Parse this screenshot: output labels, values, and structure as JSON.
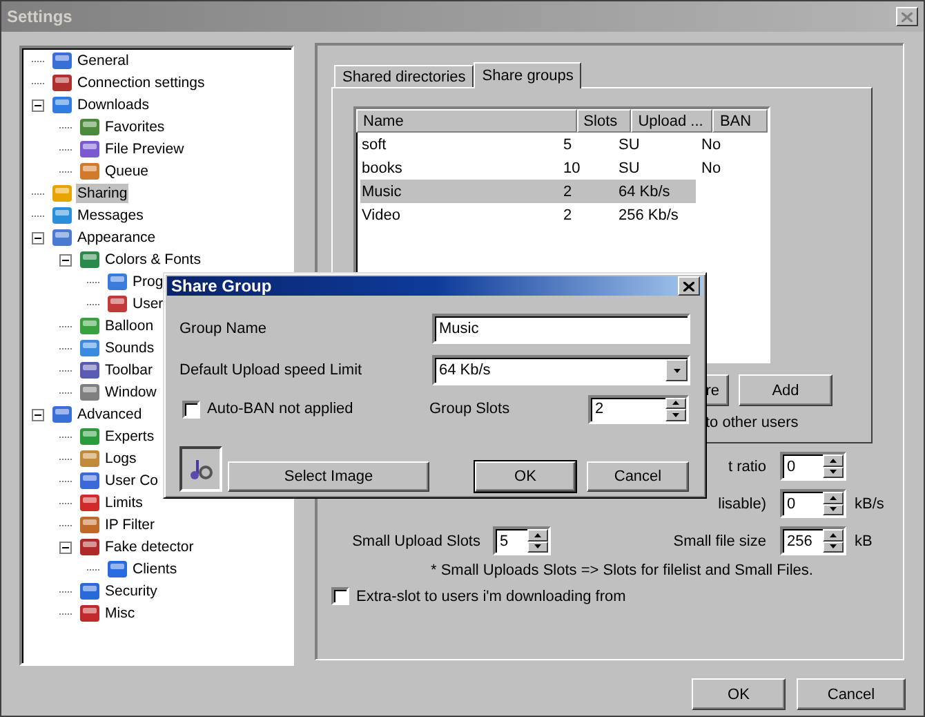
{
  "window": {
    "title": "Settings"
  },
  "tree": [
    {
      "label": "General",
      "selected": false
    },
    {
      "label": "Connection settings",
      "selected": false
    },
    {
      "label": "Downloads",
      "selected": false,
      "expanded": true,
      "children": [
        {
          "label": "Favorites",
          "selected": false
        },
        {
          "label": "File Preview",
          "selected": false
        },
        {
          "label": "Queue",
          "selected": false
        }
      ]
    },
    {
      "label": "Sharing",
      "selected": true
    },
    {
      "label": "Messages",
      "selected": false
    },
    {
      "label": "Appearance",
      "selected": false,
      "expanded": true,
      "children": [
        {
          "label": "Colors & Fonts",
          "selected": false,
          "expanded": true,
          "children": [
            {
              "label": "Prog",
              "selected": false
            },
            {
              "label": "User",
              "selected": false
            }
          ]
        },
        {
          "label": "Balloon",
          "selected": false
        },
        {
          "label": "Sounds",
          "selected": false
        },
        {
          "label": "Toolbar",
          "selected": false
        },
        {
          "label": "Window",
          "selected": false
        }
      ]
    },
    {
      "label": "Advanced",
      "selected": false,
      "expanded": true,
      "children": [
        {
          "label": "Experts",
          "selected": false
        },
        {
          "label": "Logs",
          "selected": false
        },
        {
          "label": "User Co",
          "selected": false
        },
        {
          "label": "Limits",
          "selected": false
        },
        {
          "label": "IP Filter",
          "selected": false
        },
        {
          "label": "Fake detector",
          "selected": false,
          "expanded": true,
          "children": [
            {
              "label": "Clients",
              "selected": false
            }
          ]
        },
        {
          "label": "Security",
          "selected": false
        },
        {
          "label": "Misc",
          "selected": false
        }
      ]
    }
  ],
  "tabs": [
    {
      "label": "Shared directories",
      "selected": false
    },
    {
      "label": "Share groups",
      "selected": true
    }
  ],
  "share_groups": {
    "columns": [
      "Name",
      "Slots",
      "Upload ...",
      "BAN"
    ],
    "rows": [
      {
        "name": "soft",
        "slots": "5",
        "upload": "SU",
        "ban": "No",
        "selected": false
      },
      {
        "name": "books",
        "slots": "10",
        "upload": "SU",
        "ban": "No",
        "selected": false
      },
      {
        "name": "Music",
        "slots": "2",
        "upload": "64 Kb/s",
        "selected": true
      },
      {
        "name": "Video",
        "slots": "2",
        "upload": "256 Kb/s",
        "selected": false
      }
    ]
  },
  "group_buttons": [
    "re",
    "Add"
  ],
  "group_hint": "to other users",
  "upload_settings": {
    "ratio_label": "t ratio",
    "ratio_value": "0",
    "limit_label": "lisable)",
    "limit_value": "0",
    "limit_unit": "kB/s",
    "small_slots_label": "Small Upload Slots",
    "small_slots_value": "5",
    "small_size_label": "Small file size",
    "small_size_value": "256",
    "small_size_unit": "kB",
    "note": "* Small Uploads Slots => Slots for filelist and Small Files.",
    "extra_slot": {
      "label": "Extra-slot to users i'm downloading from",
      "checked": false
    }
  },
  "buttons": [
    "OK",
    "Cancel"
  ],
  "dialog": {
    "title": "Share Group",
    "group_name": {
      "label": "Group Name",
      "value": "Music"
    },
    "speed": {
      "label": "Default Upload speed Limit",
      "value": "64 Kb/s"
    },
    "auto_ban": {
      "label": "Auto-BAN not applied",
      "checked": false
    },
    "slots": {
      "label": "Group Slots",
      "value": "2"
    },
    "buttons": [
      "Select Image",
      "OK",
      "Cancel"
    ]
  }
}
